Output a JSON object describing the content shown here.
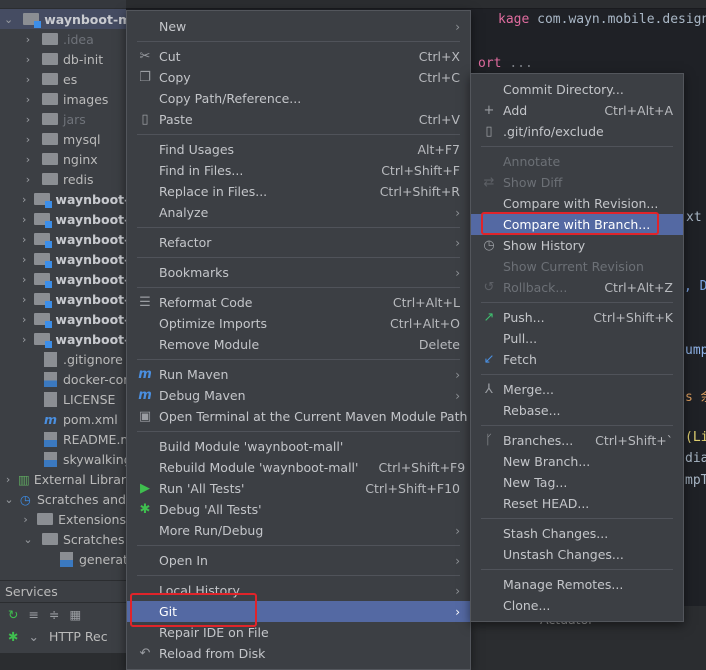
{
  "tree": {
    "root": "waynboot-mall",
    "items": [
      {
        "label": ".idea",
        "kind": "folder",
        "dim": true
      },
      {
        "label": "db-init",
        "kind": "folder"
      },
      {
        "label": "es",
        "kind": "folder"
      },
      {
        "label": "images",
        "kind": "folder"
      },
      {
        "label": "jars",
        "kind": "folder",
        "dim": true
      },
      {
        "label": "mysql",
        "kind": "folder"
      },
      {
        "label": "nginx",
        "kind": "folder"
      },
      {
        "label": "redis",
        "kind": "folder"
      },
      {
        "label": "waynboot-",
        "kind": "module"
      },
      {
        "label": "waynboot-",
        "kind": "module"
      },
      {
        "label": "waynboot-",
        "kind": "module"
      },
      {
        "label": "waynboot-",
        "kind": "module"
      },
      {
        "label": "waynboot-",
        "kind": "module"
      },
      {
        "label": "waynboot-",
        "kind": "module"
      },
      {
        "label": "waynboot-",
        "kind": "module"
      },
      {
        "label": "waynboot-",
        "kind": "module"
      }
    ],
    "files": [
      ".gitignore",
      "docker-cor",
      "LICENSE",
      "pom.xml",
      "README.m",
      "skywalking."
    ],
    "external": "External Librar",
    "scratches": "Scratches and",
    "extensions": "Extensions",
    "scratches_folder": "Scratches",
    "scratch_file": "generat"
  },
  "services": {
    "title": "Services",
    "http": "HTTP Rec"
  },
  "editor": {
    "lines": [
      "kage",
      "com.wayn.mobile.design.s",
      "ort",
      "...",
      "xt",
      ", D",
      "ump",
      "s 余",
      "(Li",
      "dia",
      "mpT"
    ],
    "bottom_tab": "Actuator"
  },
  "context_menu": [
    {
      "label": "New",
      "arrow": true
    },
    {
      "sep": true
    },
    {
      "label": "Cut",
      "shortcut": "Ctrl+X",
      "icon": "scissors-icon",
      "glyph": "✂"
    },
    {
      "label": "Copy",
      "shortcut": "Ctrl+C",
      "icon": "copy-icon",
      "glyph": "❐"
    },
    {
      "label": "Copy Path/Reference..."
    },
    {
      "label": "Paste",
      "shortcut": "Ctrl+V",
      "icon": "clipboard-icon",
      "glyph": "▯"
    },
    {
      "sep": true
    },
    {
      "label": "Find Usages",
      "shortcut": "Alt+F7"
    },
    {
      "label": "Find in Files...",
      "shortcut": "Ctrl+Shift+F"
    },
    {
      "label": "Replace in Files...",
      "shortcut": "Ctrl+Shift+R"
    },
    {
      "label": "Analyze",
      "arrow": true
    },
    {
      "sep": true
    },
    {
      "label": "Refactor",
      "arrow": true
    },
    {
      "sep": true
    },
    {
      "label": "Bookmarks",
      "arrow": true
    },
    {
      "sep": true
    },
    {
      "label": "Reformat Code",
      "shortcut": "Ctrl+Alt+L",
      "icon": "reformat-icon",
      "glyph": "☰"
    },
    {
      "label": "Optimize Imports",
      "shortcut": "Ctrl+Alt+O"
    },
    {
      "label": "Remove Module",
      "shortcut": "Delete"
    },
    {
      "sep": true
    },
    {
      "label": "Run Maven",
      "arrow": true,
      "icon": "maven-run-icon",
      "glyph": "m"
    },
    {
      "label": "Debug Maven",
      "arrow": true,
      "icon": "maven-debug-icon",
      "glyph": "m"
    },
    {
      "label": "Open Terminal at the Current Maven Module Path",
      "icon": "terminal-icon",
      "glyph": "▣"
    },
    {
      "sep": true
    },
    {
      "label": "Build Module 'waynboot-mall'"
    },
    {
      "label": "Rebuild Module 'waynboot-mall'",
      "shortcut": "Ctrl+Shift+F9"
    },
    {
      "label": "Run 'All Tests'",
      "shortcut": "Ctrl+Shift+F10",
      "icon": "run-icon",
      "glyph": "▶"
    },
    {
      "label": "Debug 'All Tests'",
      "icon": "debug-bug-icon",
      "glyph": "✱"
    },
    {
      "label": "More Run/Debug",
      "arrow": true
    },
    {
      "sep": true
    },
    {
      "label": "Open In",
      "arrow": true
    },
    {
      "sep": true
    },
    {
      "label": "Local History",
      "arrow": true
    },
    {
      "label": "Git",
      "arrow": true,
      "highlight": true
    },
    {
      "label": "Repair IDE on File"
    },
    {
      "label": "Reload from Disk",
      "icon": "reload-icon",
      "glyph": "↶"
    }
  ],
  "git_menu": [
    {
      "label": "Commit Directory..."
    },
    {
      "label": "Add",
      "shortcut": "Ctrl+Alt+A",
      "icon": "plus-icon",
      "glyph": "+"
    },
    {
      "label": ".git/info/exclude",
      "icon": "ignore-file-icon",
      "glyph": "▯"
    },
    {
      "sep": true
    },
    {
      "label": "Annotate",
      "disabled": true
    },
    {
      "label": "Show Diff",
      "disabled": true,
      "icon": "diff-icon",
      "glyph": "⇄"
    },
    {
      "label": "Compare with Revision..."
    },
    {
      "label": "Compare with Branch...",
      "highlight": true
    },
    {
      "label": "Show History",
      "icon": "clock-icon",
      "glyph": "◷"
    },
    {
      "label": "Show Current Revision",
      "disabled": true
    },
    {
      "label": "Rollback...",
      "shortcut": "Ctrl+Alt+Z",
      "disabled": true,
      "icon": "rollback-icon",
      "glyph": "↺"
    },
    {
      "sep": true
    },
    {
      "label": "Push...",
      "shortcut": "Ctrl+Shift+K",
      "icon": "push-arrow-icon",
      "glyph": "↗"
    },
    {
      "label": "Pull..."
    },
    {
      "label": "Fetch",
      "icon": "fetch-arrow-icon",
      "glyph": "↙"
    },
    {
      "sep": true
    },
    {
      "label": "Merge...",
      "icon": "merge-icon",
      "glyph": "⅄"
    },
    {
      "label": "Rebase..."
    },
    {
      "sep": true
    },
    {
      "label": "Branches...",
      "shortcut": "Ctrl+Shift+`",
      "icon": "branch-icon",
      "glyph": "ᚴ"
    },
    {
      "label": "New Branch..."
    },
    {
      "label": "New Tag..."
    },
    {
      "label": "Reset HEAD..."
    },
    {
      "sep": true
    },
    {
      "label": "Stash Changes..."
    },
    {
      "label": "Unstash Changes..."
    },
    {
      "sep": true
    },
    {
      "label": "Manage Remotes..."
    },
    {
      "label": "Clone..."
    }
  ],
  "colors": {
    "highlight": "#5469a3",
    "annotation": "#e0242a",
    "push": "#3fbf6f",
    "fetch": "#4a8fe0",
    "run": "#3fbf4f"
  }
}
